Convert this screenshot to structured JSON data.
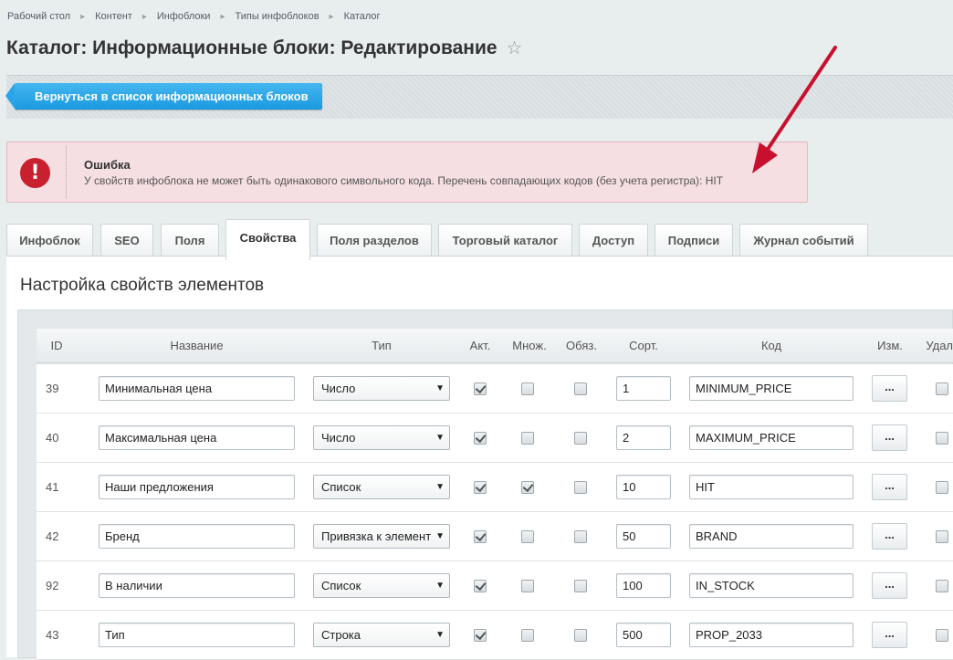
{
  "breadcrumbs": [
    "Рабочий стол",
    "Контент",
    "Инфоблоки",
    "Типы инфоблоков",
    "Каталог"
  ],
  "page_title": "Каталог: Информационные блоки: Редактирование",
  "back_button": "Вернуться в список информационных блоков",
  "error": {
    "title": "Ошибка",
    "icon": "!",
    "message": "У свойств инфоблока не может быть одинакового символьного кода. Перечень совпадающих кодов (без учета регистра): HIT"
  },
  "tabs": [
    "Инфоблок",
    "SEO",
    "Поля",
    "Свойства",
    "Поля разделов",
    "Торговый каталог",
    "Доступ",
    "Подписи",
    "Журнал событий"
  ],
  "active_tab": "Свойства",
  "section_title": "Настройка свойств элементов",
  "columns": {
    "id": "ID",
    "name": "Название",
    "type": "Тип",
    "active": "Акт.",
    "multiple": "Множ.",
    "required": "Обяз.",
    "sort": "Сорт.",
    "code": "Код",
    "edit": "Изм.",
    "delete": "Удал."
  },
  "edit_button_label": "...",
  "rows": [
    {
      "id": "39",
      "name": "Минимальная цена",
      "type": "Число",
      "active": true,
      "multiple": false,
      "required": false,
      "sort": "1",
      "code": "MINIMUM_PRICE",
      "delete": false
    },
    {
      "id": "40",
      "name": "Максимальная цена",
      "type": "Число",
      "active": true,
      "multiple": false,
      "required": false,
      "sort": "2",
      "code": "MAXIMUM_PRICE",
      "delete": false
    },
    {
      "id": "41",
      "name": "Наши предложения",
      "type": "Список",
      "active": true,
      "multiple": true,
      "required": false,
      "sort": "10",
      "code": "HIT",
      "delete": false
    },
    {
      "id": "42",
      "name": "Бренд",
      "type": "Привязка к элемент",
      "active": true,
      "multiple": false,
      "required": false,
      "sort": "50",
      "code": "BRAND",
      "delete": false
    },
    {
      "id": "92",
      "name": "В наличии",
      "type": "Список",
      "active": true,
      "multiple": false,
      "required": false,
      "sort": "100",
      "code": "IN_STOCK",
      "delete": false
    },
    {
      "id": "43",
      "name": "Тип",
      "type": "Строка",
      "active": true,
      "multiple": false,
      "required": false,
      "sort": "500",
      "code": "PROP_2033",
      "delete": false
    }
  ],
  "colors": {
    "accent": "#1a9ae0",
    "error": "#c8202e",
    "arrow": "#c8102e"
  }
}
